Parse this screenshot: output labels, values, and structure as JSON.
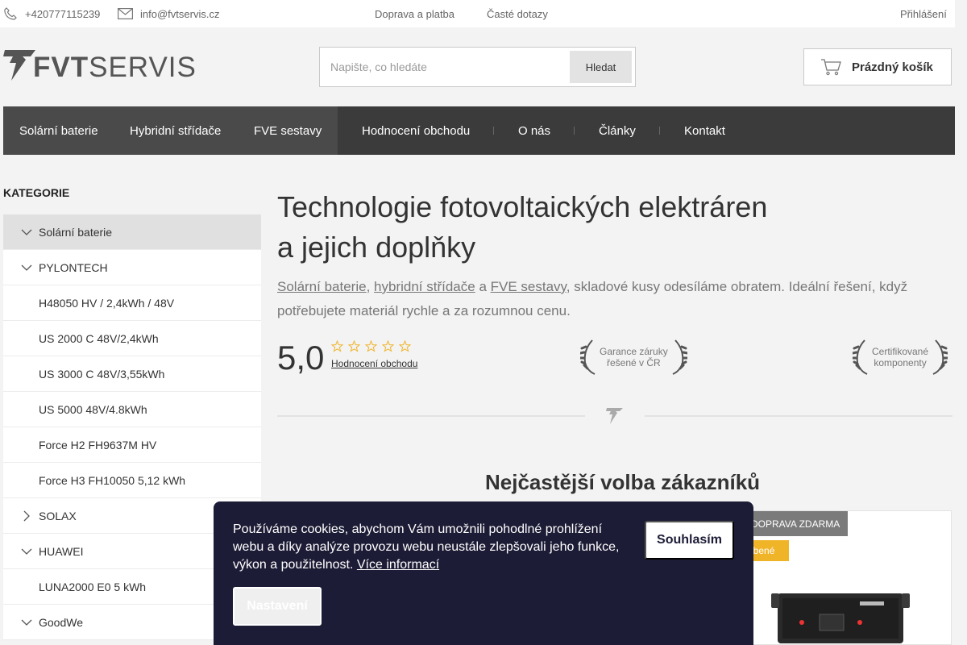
{
  "topbar": {
    "phone": "+420777115239",
    "email": "info@fvtservis.cz",
    "links": [
      "Doprava a platba",
      "Časté dotazy"
    ],
    "login": "Přihlášení"
  },
  "header": {
    "logo_bold": "FVT",
    "logo_light": "SERVIS",
    "search_placeholder": "Napište, co hledáte",
    "search_button": "Hledat",
    "cart_label": "Prázdný košík"
  },
  "nav": {
    "items": [
      "Solární baterie",
      "Hybridní střídače",
      "FVE sestavy",
      "Hodnocení obchodu",
      "O nás",
      "Články",
      "Kontakt"
    ]
  },
  "sidebar": {
    "title": "KATEGORIE",
    "items": [
      {
        "label": "Solární baterie",
        "chevron": "down"
      },
      {
        "label": "PYLONTECH",
        "chevron": "down"
      },
      {
        "label": "H48050 HV / 2,4kWh / 48V",
        "chevron": ""
      },
      {
        "label": "US 2000 C 48V/2,4kWh",
        "chevron": ""
      },
      {
        "label": "US 3000 C 48V/3,55kWh",
        "chevron": ""
      },
      {
        "label": "US 5000 48V/4.8kWh",
        "chevron": ""
      },
      {
        "label": "Force H2 FH9637M HV",
        "chevron": ""
      },
      {
        "label": "Force H3 FH10050 5,12 kWh",
        "chevron": ""
      },
      {
        "label": "SOLAX",
        "chevron": "right"
      },
      {
        "label": "HUAWEI",
        "chevron": "down"
      },
      {
        "label": "LUNA2000 E0 5 kWh",
        "chevron": ""
      },
      {
        "label": "GoodWe",
        "chevron": "down"
      }
    ]
  },
  "main": {
    "title_line1": "Technologie fotovoltaických elektráren",
    "title_line2": "a jejich doplňky",
    "intro_link1": "Solární baterie",
    "intro_sep1": ", ",
    "intro_link2": "hybridní střídače",
    "intro_sep2": " a ",
    "intro_link3": "FVE sestavy",
    "intro_rest": ", skladové kusy odesíláme obratem. Ideální řešení, když potřebujete materiál rychle a za rozumnou cenu.",
    "rating_value": "5,0",
    "rating_stars": 5,
    "rating_link": "Hodnocení obchodu",
    "badge1_line1": "Garance záruky",
    "badge1_line2": "řešené v ČR",
    "badge2_line1": "Certifikované",
    "badge2_line2": "komponenty",
    "section_title": "Nejčastější volba zákazníků"
  },
  "product": {
    "tag_free": "DOPRAVA ZDARMA",
    "tag_fav": "ibené"
  },
  "cookie": {
    "text": "Používáme cookies, abychom Vám umožnili pohodlné prohlížení webu a díky analýze provozu webu neustále zlepšovali jeho funkce, výkon a použitelnost. ",
    "more_link": "Více informací",
    "accept": "Souhlasím",
    "settings": "Nastavení"
  },
  "colors": {
    "nav_bg": "#3b3b3b",
    "nav_highlight": "#4a4a4a",
    "star": "#f0b429",
    "cookie_bg": "#1c1c36",
    "tag_gray": "#7b7b7b"
  }
}
